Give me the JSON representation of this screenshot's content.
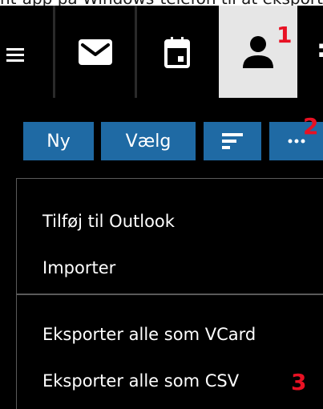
{
  "caption": "nt-app på Windows-telefon til at eksportere kontakter til en fil, og vælg derefter Eksportér alle",
  "nav": {
    "items": [
      {
        "name": "Mail",
        "icon": "mail-icon"
      },
      {
        "name": "Kalender",
        "icon": "calendar-icon"
      },
      {
        "name": "Personer",
        "icon": "person-icon",
        "selected": true
      }
    ],
    "overflow_glyph": ":"
  },
  "toolbar": {
    "new_label": "Ny",
    "select_label": "Vælg",
    "sort_icon": "sort-icon",
    "more_label": "..."
  },
  "menu": {
    "items": [
      "Tilføj til Outlook",
      "Importer",
      "Eksporter alle som VCard",
      "Eksporter alle som CSV"
    ]
  },
  "callouts": [
    "1",
    "2",
    "3"
  ],
  "colors": {
    "background": "#000000",
    "selected_tab": "#e6e6e6",
    "toolbar_button": "#1f6aa4",
    "callout": "#e81123",
    "divider": "#5a5a5a"
  }
}
